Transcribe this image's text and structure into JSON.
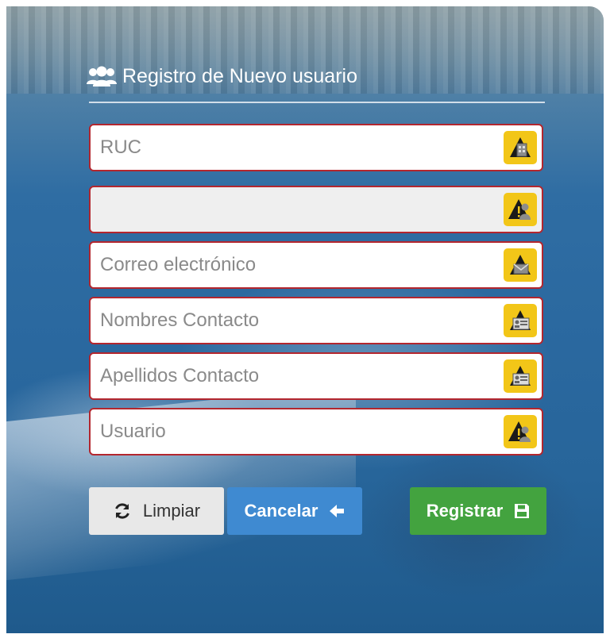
{
  "form": {
    "title": "Registro de Nuevo usuario",
    "fields": [
      {
        "placeholder": "RUC",
        "value": "",
        "icon": "building-alert-icon",
        "disabled": false
      },
      {
        "placeholder": "",
        "value": "",
        "icon": "user-alert-icon",
        "disabled": true
      },
      {
        "placeholder": "Correo electrónico",
        "value": "",
        "icon": "envelope-alert-icon",
        "disabled": false
      },
      {
        "placeholder": "Nombres Contacto",
        "value": "",
        "icon": "id-card-alert-icon",
        "disabled": false
      },
      {
        "placeholder": "Apellidos Contacto",
        "value": "",
        "icon": "id-card-alert-icon",
        "disabled": false
      },
      {
        "placeholder": "Usuario",
        "value": "",
        "icon": "user-alert-icon",
        "disabled": false
      }
    ]
  },
  "buttons": {
    "clear_label": "Limpiar",
    "cancel_label": "Cancelar",
    "submit_label": "Registrar"
  },
  "colors": {
    "field_border": "#b3262e",
    "warning_badge": "#f2c618",
    "clear_bg": "#e8e8e8",
    "cancel_bg": "#3f8ad1",
    "submit_bg": "#43a33f"
  }
}
